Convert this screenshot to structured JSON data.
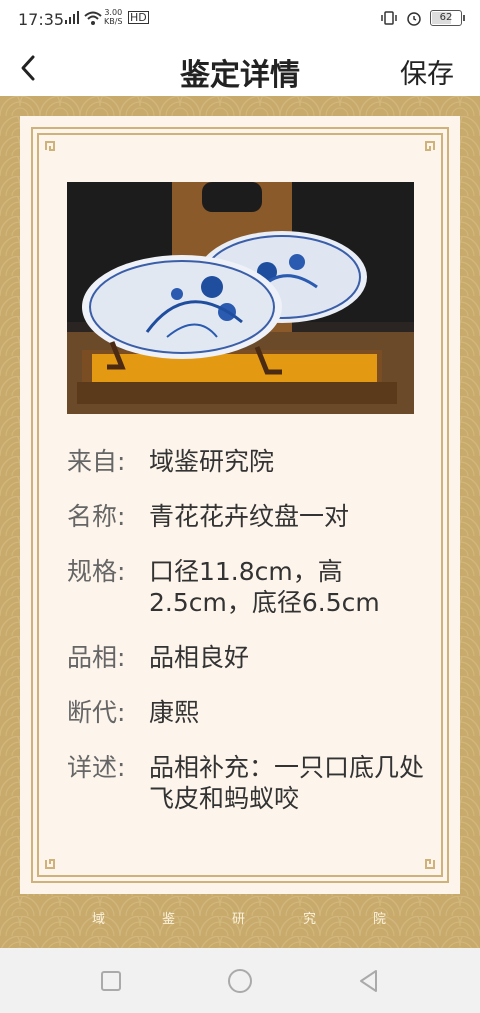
{
  "status_bar": {
    "time": "17:35",
    "net_speed_top": "3.00",
    "net_speed_bottom": "KB/S",
    "hd": "HD",
    "battery": "62"
  },
  "header": {
    "title": "鉴定详情",
    "save_label": "保存"
  },
  "details": [
    {
      "label": "来自:",
      "value": "域鉴研究院"
    },
    {
      "label": "名称:",
      "value": "青花花卉纹盘一对"
    },
    {
      "label": "规格:",
      "value": "口径11.8cm，高2.5cm，底径6.5cm"
    },
    {
      "label": "品相:",
      "value": "品相良好"
    },
    {
      "label": "断代:",
      "value": "康熙"
    },
    {
      "label": "详述:",
      "value": "品相补充：一只口底几处飞皮和蚂蚁咬"
    }
  ],
  "footer": {
    "chars": [
      "域",
      "鉴",
      "研",
      "究",
      "院"
    ]
  },
  "colors": {
    "gold": "#c8ab6c",
    "card": "#fdf5ec",
    "frame": "#cfb27a"
  }
}
